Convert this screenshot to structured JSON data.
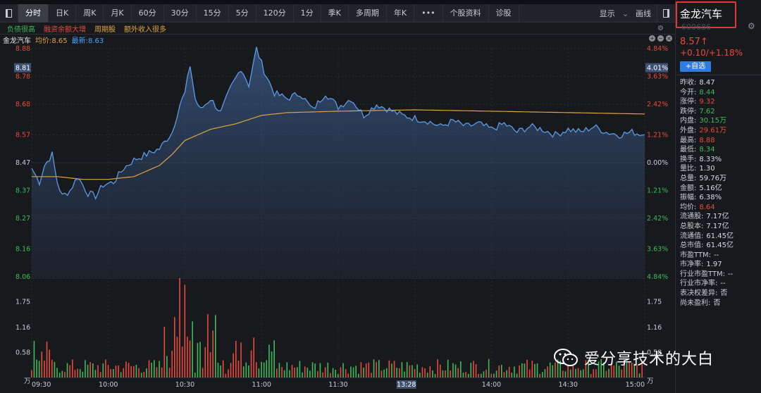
{
  "toolbar": {
    "tabs": [
      "分时",
      "日K",
      "周K",
      "月K",
      "60分",
      "30分",
      "15分",
      "5分",
      "120分",
      "1分",
      "季K",
      "多周期",
      "年K",
      "•••",
      "个股资料",
      "诊股"
    ],
    "right": [
      "显示",
      "画线"
    ]
  },
  "tags": [
    "负债很高",
    "融资余额大增",
    "周期股",
    "额外收入很多"
  ],
  "legend": {
    "name": "金龙汽车",
    "avg": "均价:8.65",
    "latest": "最新:8.63"
  },
  "side": {
    "name": "金龙汽车",
    "code": "600686",
    "price": "8.57↑",
    "change": "+0.10/+1.18%",
    "add_label": "+自选",
    "stats": [
      {
        "k": "昨收:",
        "v": "8.47",
        "c": "wh"
      },
      {
        "k": "今开:",
        "v": "8.44",
        "c": "dn"
      },
      {
        "k": "涨停:",
        "v": "9.32",
        "c": "up"
      },
      {
        "k": "跌停:",
        "v": "7.62",
        "c": "dn"
      },
      {
        "k": "内盘:",
        "v": "30.15万",
        "c": "dn"
      },
      {
        "k": "外盘:",
        "v": "29.61万",
        "c": "up"
      },
      {
        "k": "最高:",
        "v": "8.88",
        "c": "up"
      },
      {
        "k": "最低:",
        "v": "8.34",
        "c": "dn"
      },
      {
        "k": "换手:",
        "v": "8.33%",
        "c": "wh"
      },
      {
        "k": "量比:",
        "v": "1.30",
        "c": "wh"
      },
      {
        "k": "总量:",
        "v": "59.76万",
        "c": "wh"
      },
      {
        "k": "金额:",
        "v": "5.16亿",
        "c": "wh"
      },
      {
        "k": "振幅:",
        "v": "6.38%",
        "c": "wh"
      },
      {
        "k": "均价:",
        "v": "8.64",
        "c": "up"
      },
      {
        "k": "流通股:",
        "v": "7.17亿",
        "c": "wh"
      },
      {
        "k": "总股本:",
        "v": "7.17亿",
        "c": "wh"
      },
      {
        "k": "流通值:",
        "v": "61.45亿",
        "c": "wh"
      },
      {
        "k": "总市值:",
        "v": "61.45亿",
        "c": "wh"
      },
      {
        "k": "市盈TTM:",
        "v": "--",
        "c": "wh"
      },
      {
        "k": "市净率:",
        "v": "1.97",
        "c": "wh"
      },
      {
        "k": "行业市盈TTM:",
        "v": "--",
        "c": "wh"
      },
      {
        "k": "行业市净率:",
        "v": "--",
        "c": "wh"
      },
      {
        "k": "表决权差异:",
        "v": "否",
        "c": "wh"
      },
      {
        "k": "尚未盈利:",
        "v": "否",
        "c": "wh"
      }
    ]
  },
  "watermark": "爱分享技术的大白",
  "colors": {
    "up": "#e84a3c",
    "down": "#3dbb5a",
    "price_line": "#5b9be8",
    "avg_line": "#e0a33e",
    "bg": "#17191d"
  },
  "chart_data": {
    "type": "line",
    "prev_close": 8.47,
    "ylim": [
      8.06,
      8.88
    ],
    "price_ticks": [
      "8.88",
      "8.78",
      "8.68",
      "8.57",
      "8.47",
      "8.37",
      "8.27",
      "8.16",
      "8.06"
    ],
    "pct_ticks": [
      "4.84%",
      "3.63%",
      "2.42%",
      "1.21%",
      "0.00%",
      "1.21%",
      "2.42%",
      "3.63%",
      "4.84%"
    ],
    "cursor_price": "8.81",
    "cursor_pct": "4.01%",
    "x_ticks": [
      "09:30",
      "10:00",
      "10:30",
      "11:00",
      "11:30",
      "13:28",
      "14:00",
      "14:30",
      "15:00"
    ],
    "cursor_time": "13:28",
    "volume_ticks": [
      "1.75",
      "1.16",
      "0.58"
    ],
    "volume_unit": "万",
    "volume_max": 2.3,
    "price_key": [
      [
        0,
        8.45
      ],
      [
        3,
        8.4
      ],
      [
        5,
        8.46
      ],
      [
        8,
        8.5
      ],
      [
        10,
        8.4
      ],
      [
        12,
        8.35
      ],
      [
        15,
        8.37
      ],
      [
        18,
        8.42
      ],
      [
        22,
        8.36
      ],
      [
        25,
        8.35
      ],
      [
        28,
        8.39
      ],
      [
        32,
        8.4
      ],
      [
        36,
        8.45
      ],
      [
        40,
        8.48
      ],
      [
        45,
        8.5
      ],
      [
        50,
        8.52
      ],
      [
        55,
        8.58
      ],
      [
        58,
        8.68
      ],
      [
        60,
        8.72
      ],
      [
        62,
        8.82
      ],
      [
        64,
        8.7
      ],
      [
        66,
        8.66
      ],
      [
        70,
        8.7
      ],
      [
        74,
        8.65
      ],
      [
        78,
        8.74
      ],
      [
        82,
        8.81
      ],
      [
        85,
        8.75
      ],
      [
        88,
        8.88
      ],
      [
        91,
        8.8
      ],
      [
        95,
        8.72
      ],
      [
        100,
        8.7
      ],
      [
        105,
        8.72
      ],
      [
        110,
        8.66
      ],
      [
        115,
        8.72
      ],
      [
        120,
        8.67
      ],
      [
        125,
        8.7
      ],
      [
        130,
        8.64
      ],
      [
        135,
        8.68
      ],
      [
        140,
        8.66
      ],
      [
        145,
        8.64
      ],
      [
        150,
        8.63
      ],
      [
        155,
        8.62
      ],
      [
        160,
        8.6
      ],
      [
        165,
        8.62
      ],
      [
        170,
        8.6
      ],
      [
        175,
        8.61
      ],
      [
        180,
        8.59
      ],
      [
        185,
        8.61
      ],
      [
        190,
        8.58
      ],
      [
        195,
        8.6
      ],
      [
        200,
        8.59
      ],
      [
        205,
        8.57
      ],
      [
        210,
        8.59
      ],
      [
        215,
        8.58
      ],
      [
        220,
        8.6
      ],
      [
        225,
        8.58
      ],
      [
        230,
        8.57
      ],
      [
        235,
        8.58
      ],
      [
        240,
        8.57
      ]
    ],
    "avg_key": [
      [
        0,
        8.42
      ],
      [
        10,
        8.42
      ],
      [
        20,
        8.41
      ],
      [
        30,
        8.41
      ],
      [
        40,
        8.42
      ],
      [
        50,
        8.46
      ],
      [
        55,
        8.5
      ],
      [
        60,
        8.55
      ],
      [
        70,
        8.59
      ],
      [
        80,
        8.61
      ],
      [
        90,
        8.64
      ],
      [
        100,
        8.65
      ],
      [
        120,
        8.655
      ],
      [
        150,
        8.66
      ],
      [
        180,
        8.655
      ],
      [
        210,
        8.65
      ],
      [
        240,
        8.645
      ]
    ]
  }
}
